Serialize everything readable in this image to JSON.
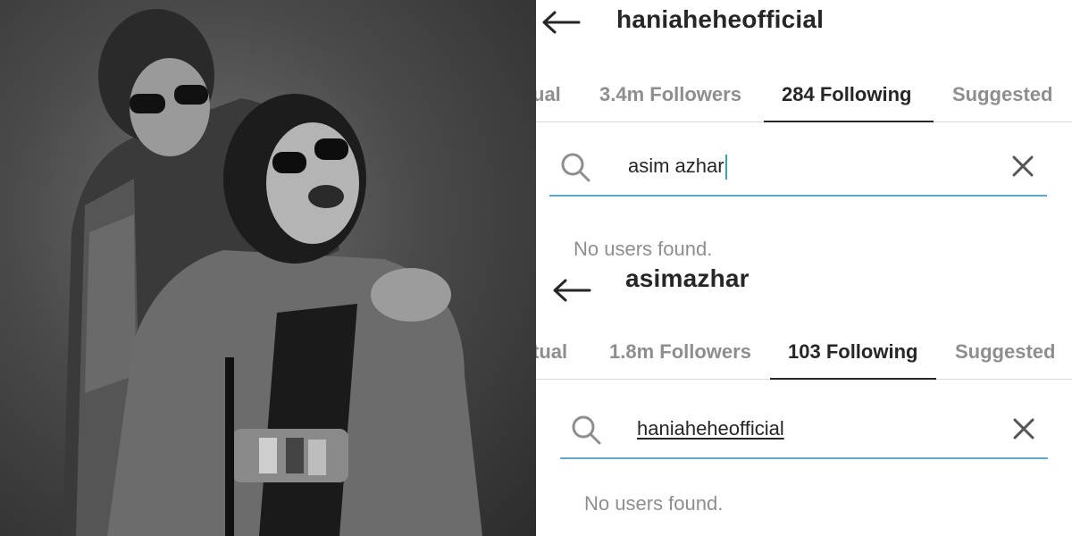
{
  "panels": [
    {
      "username": "haniaheheofficial",
      "tabs": [
        "ual",
        "3.4m Followers",
        "284 Following",
        "Suggested"
      ],
      "active_tab": "284 Following",
      "search": {
        "value": "asim azhar"
      },
      "empty_message": "No users found."
    },
    {
      "username": "asimazhar",
      "tabs": [
        "tual",
        "1.8m Followers",
        "103 Following",
        "Suggested"
      ],
      "active_tab": "103 Following",
      "search": {
        "value": "haniaheheofficial"
      },
      "empty_message": "No users found."
    }
  ],
  "icons": [
    "back-arrow-icon",
    "search-icon",
    "close-icon"
  ],
  "colors": {
    "text": "#262626",
    "muted": "#8e8e8e",
    "search_underline": "#5fa8c6",
    "caret": "#3aa2a8"
  }
}
